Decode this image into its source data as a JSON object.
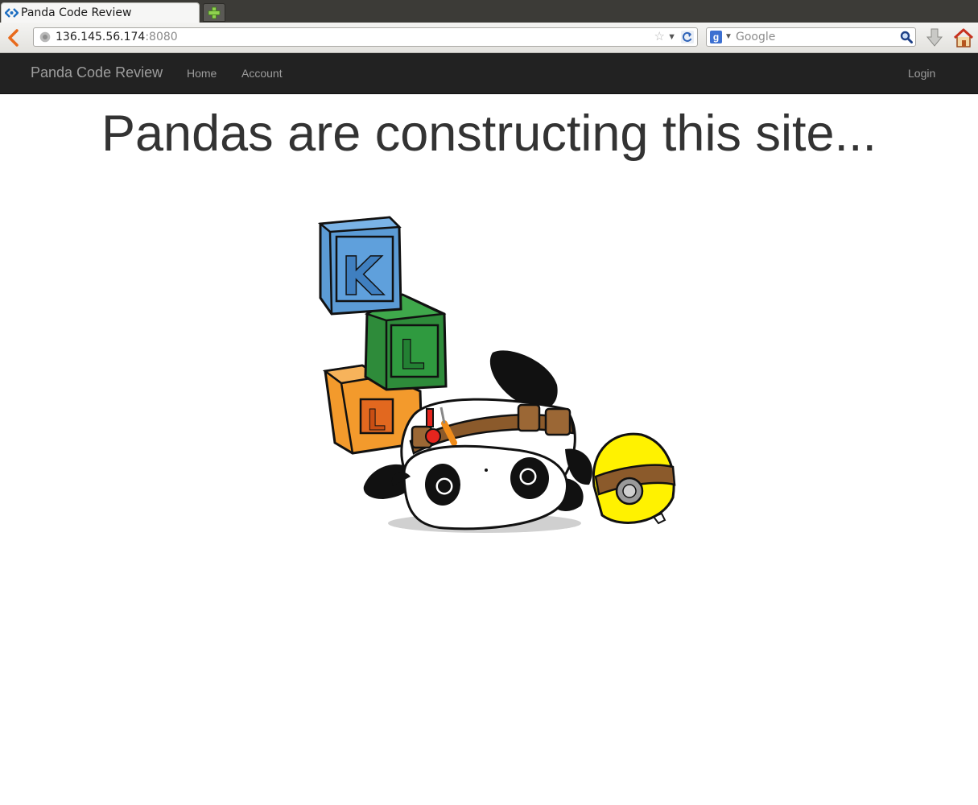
{
  "browser": {
    "tab_title": "Panda Code Review",
    "url_host": "136.145.56.174",
    "url_port": ":8080",
    "search_placeholder": "Google",
    "search_engine_letter": "g"
  },
  "site": {
    "brand": "Panda Code Review",
    "nav": {
      "home": "Home",
      "account": "Account",
      "login": "Login"
    },
    "headline": "Pandas are constructing this site...",
    "illustration": {
      "blocks": [
        "K",
        "L",
        "L"
      ],
      "colors": {
        "block_blue": "#5b9bd5",
        "block_green": "#2e8b3a",
        "block_orange": "#f39a2c",
        "helmet_yellow": "#fff200",
        "belt_brown": "#8b5a2b"
      }
    }
  },
  "icons": {
    "favicon": "code-review-favicon",
    "new_tab": "plus-icon",
    "back": "back-arrow-icon",
    "globe": "globe-icon",
    "bookmark": "star-icon",
    "reload": "reload-icon",
    "search": "magnifier-icon",
    "download": "download-icon",
    "home": "home-icon"
  }
}
